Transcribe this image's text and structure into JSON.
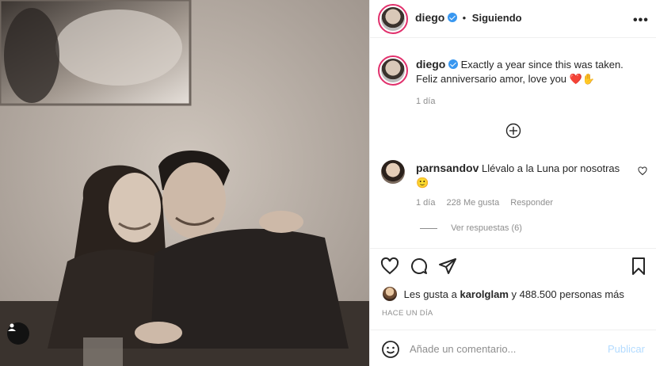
{
  "post": {
    "author": "diego",
    "follow_status": "Siguiendo",
    "separator": "•",
    "more_label": "•••"
  },
  "caption": {
    "author": "diego",
    "text": "Exactly a year since this was taken. Feliz anniversario amor, love you ❤️✋",
    "time": "1 día"
  },
  "comment": {
    "author": "parnsandov",
    "text": "Llévalo a la Luna por nosotras 🙂",
    "time": "1 día",
    "likes": "228 Me gusta",
    "reply_label": "Responder",
    "view_replies": "Ver respuestas (6)"
  },
  "likes": {
    "text_prefix": "Les gusta a",
    "user": "karolglam",
    "text_suffix": "y 488.500 personas más"
  },
  "posted": "HACE UN DÍA",
  "composer": {
    "placeholder": "Añade un comentario...",
    "publish_label": "Publicar"
  },
  "icons": {
    "more": "more-options-icon",
    "add": "plus-circle-icon",
    "like": "heart-icon",
    "comment": "comment-icon",
    "share": "share-icon",
    "save": "bookmark-icon",
    "emoji": "emoji-icon",
    "tag": "user-tag-icon"
  },
  "colors": {
    "text": "#262626",
    "muted": "#8e8e8e",
    "verified": "#3897f0",
    "publish_disabled": "#b3dbff"
  }
}
